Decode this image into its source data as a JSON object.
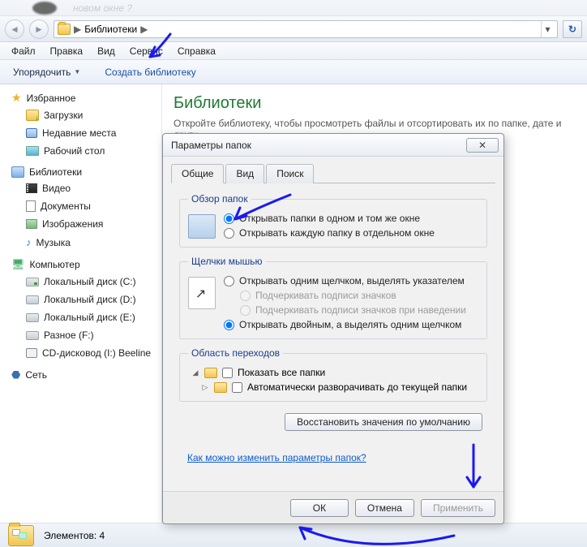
{
  "address": {
    "root_label": "Библиотеки",
    "separator": "▶",
    "dropdown_glyph": "▾"
  },
  "nav": {
    "back_glyph": "◄",
    "fwd_glyph": "►",
    "refresh_glyph": "↻"
  },
  "menu": {
    "file": "Файл",
    "edit": "Правка",
    "view": "Вид",
    "tools": "Сервис",
    "help": "Справка"
  },
  "toolbar": {
    "organize": "Упорядочить",
    "new_library": "Создать библиотеку"
  },
  "sidebar": {
    "favorites": "Избранное",
    "downloads": "Загрузки",
    "recent": "Недавние места",
    "desktop": "Рабочий стол",
    "libraries": "Библиотеки",
    "videos": "Видео",
    "documents": "Документы",
    "pictures": "Изображения",
    "music": "Музыка",
    "computer": "Компьютер",
    "disk_c": "Локальный диск (C:)",
    "disk_d": "Локальный диск (D:)",
    "disk_e": "Локальный диск (E:)",
    "disk_f": "Разное (F:)",
    "disk_i": "CD-дисковод (I:) Beeline",
    "network": "Сеть"
  },
  "content": {
    "title": "Библиотеки",
    "subtitle": "Откройте библиотеку, чтобы просмотреть файлы и отсортировать их по папке, дате и други"
  },
  "status": {
    "elements_label": "Элементов:",
    "elements_count": "4"
  },
  "dialog": {
    "title": "Параметры папок",
    "tabs": {
      "general": "Общие",
      "view": "Вид",
      "search": "Поиск"
    },
    "browse": {
      "legend": "Обзор папок",
      "same_window": "Открывать папки в одном и том же окне",
      "new_window": "Открывать каждую папку в отдельном окне"
    },
    "click": {
      "legend": "Щелчки мышью",
      "single": "Открывать одним щелчком, выделять указателем",
      "underline_always": "Подчеркивать подписи значков",
      "underline_hover": "Подчеркивать подписи значков при наведении",
      "double": "Открывать двойным, а выделять одним щелчком"
    },
    "navpane": {
      "legend": "Область переходов",
      "show_all": "Показать все папки",
      "auto_expand": "Автоматически разворачивать до текущей папки"
    },
    "restore_defaults": "Восстановить значения по умолчанию",
    "help_link": "Как можно изменить параметры папок?",
    "buttons": {
      "ok": "ОК",
      "cancel": "Отмена",
      "apply": "Применить"
    }
  }
}
